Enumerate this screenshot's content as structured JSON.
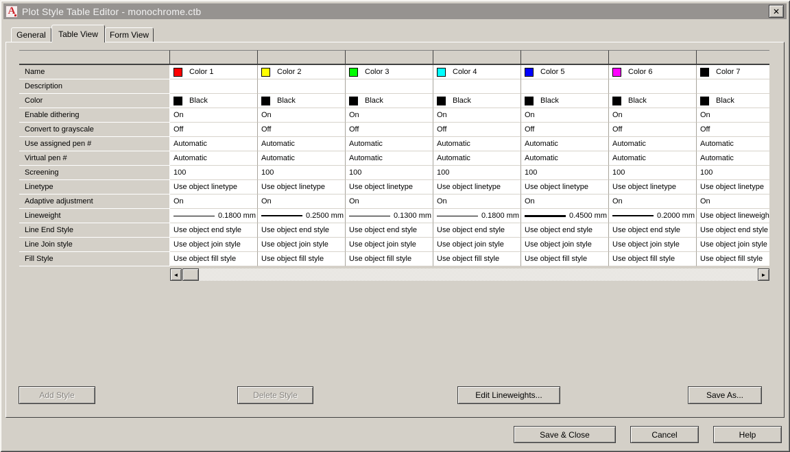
{
  "window": {
    "title": "Plot Style Table Editor - monochrome.ctb",
    "icon_letter": "A",
    "close_glyph": "✕"
  },
  "tabs": [
    {
      "label": "General",
      "active": false
    },
    {
      "label": "Table View",
      "active": true
    },
    {
      "label": "Form View",
      "active": false
    }
  ],
  "table": {
    "rows": [
      {
        "key": "name",
        "label": "Name",
        "kind": "name"
      },
      {
        "key": "description",
        "label": "Description",
        "kind": "text"
      },
      {
        "key": "color",
        "label": "Color",
        "kind": "swatchtext"
      },
      {
        "key": "enable_dithering",
        "label": "Enable dithering",
        "kind": "text"
      },
      {
        "key": "convert_to_grayscale",
        "label": "Convert to grayscale",
        "kind": "text"
      },
      {
        "key": "use_assigned_pen",
        "label": "Use assigned pen #",
        "kind": "text"
      },
      {
        "key": "virtual_pen",
        "label": "Virtual pen #",
        "kind": "text"
      },
      {
        "key": "screening",
        "label": "Screening",
        "kind": "text"
      },
      {
        "key": "linetype",
        "label": "Linetype",
        "kind": "text"
      },
      {
        "key": "adaptive_adjustment",
        "label": "Adaptive adjustment",
        "kind": "text"
      },
      {
        "key": "lineweight",
        "label": "Lineweight",
        "kind": "lineweight"
      },
      {
        "key": "line_end_style",
        "label": "Line End Style",
        "kind": "text"
      },
      {
        "key": "line_join_style",
        "label": "Line Join style",
        "kind": "text"
      },
      {
        "key": "fill_style",
        "label": "Fill Style",
        "kind": "text"
      }
    ],
    "columns": [
      {
        "name": "Color 1",
        "swatch": "#ff0000",
        "values": {
          "description": "",
          "color": "Black",
          "color_swatch": "#000000",
          "enable_dithering": "On",
          "convert_to_grayscale": "Off",
          "use_assigned_pen": "Automatic",
          "virtual_pen": "Automatic",
          "screening": "100",
          "linetype": "Use object linetype",
          "adaptive_adjustment": "On",
          "lineweight": "0.1800 mm",
          "lineweight_thickness": 1,
          "line_end_style": "Use object end style",
          "line_join_style": "Use object join style",
          "fill_style": "Use object fill style"
        }
      },
      {
        "name": "Color 2",
        "swatch": "#ffff00",
        "values": {
          "description": "",
          "color": "Black",
          "color_swatch": "#000000",
          "enable_dithering": "On",
          "convert_to_grayscale": "Off",
          "use_assigned_pen": "Automatic",
          "virtual_pen": "Automatic",
          "screening": "100",
          "linetype": "Use object linetype",
          "adaptive_adjustment": "On",
          "lineweight": "0.2500 mm",
          "lineweight_thickness": 2,
          "line_end_style": "Use object end style",
          "line_join_style": "Use object join style",
          "fill_style": "Use object fill style"
        }
      },
      {
        "name": "Color 3",
        "swatch": "#00ff00",
        "values": {
          "description": "",
          "color": "Black",
          "color_swatch": "#000000",
          "enable_dithering": "On",
          "convert_to_grayscale": "Off",
          "use_assigned_pen": "Automatic",
          "virtual_pen": "Automatic",
          "screening": "100",
          "linetype": "Use object linetype",
          "adaptive_adjustment": "On",
          "lineweight": "0.1300 mm",
          "lineweight_thickness": 1,
          "line_end_style": "Use object end style",
          "line_join_style": "Use object join style",
          "fill_style": "Use object fill style"
        }
      },
      {
        "name": "Color 4",
        "swatch": "#00ffff",
        "values": {
          "description": "",
          "color": "Black",
          "color_swatch": "#000000",
          "enable_dithering": "On",
          "convert_to_grayscale": "Off",
          "use_assigned_pen": "Automatic",
          "virtual_pen": "Automatic",
          "screening": "100",
          "linetype": "Use object linetype",
          "adaptive_adjustment": "On",
          "lineweight": "0.1800 mm",
          "lineweight_thickness": 1,
          "line_end_style": "Use object end style",
          "line_join_style": "Use object join style",
          "fill_style": "Use object fill style"
        }
      },
      {
        "name": "Color 5",
        "swatch": "#0000ff",
        "values": {
          "description": "",
          "color": "Black",
          "color_swatch": "#000000",
          "enable_dithering": "On",
          "convert_to_grayscale": "Off",
          "use_assigned_pen": "Automatic",
          "virtual_pen": "Automatic",
          "screening": "100",
          "linetype": "Use object linetype",
          "adaptive_adjustment": "On",
          "lineweight": "0.4500 mm",
          "lineweight_thickness": 3,
          "line_end_style": "Use object end style",
          "line_join_style": "Use object join style",
          "fill_style": "Use object fill style"
        }
      },
      {
        "name": "Color 6",
        "swatch": "#ff00ff",
        "values": {
          "description": "",
          "color": "Black",
          "color_swatch": "#000000",
          "enable_dithering": "On",
          "convert_to_grayscale": "Off",
          "use_assigned_pen": "Automatic",
          "virtual_pen": "Automatic",
          "screening": "100",
          "linetype": "Use object linetype",
          "adaptive_adjustment": "On",
          "lineweight": "0.2000 mm",
          "lineweight_thickness": 2,
          "line_end_style": "Use object end style",
          "line_join_style": "Use object join style",
          "fill_style": "Use object fill style"
        }
      },
      {
        "name": "Color 7",
        "swatch": "#000000",
        "values": {
          "description": "",
          "color": "Black",
          "color_swatch": "#000000",
          "enable_dithering": "On",
          "convert_to_grayscale": "Off",
          "use_assigned_pen": "Automatic",
          "virtual_pen": "Automatic",
          "screening": "100",
          "linetype": "Use object linetype",
          "adaptive_adjustment": "On",
          "lineweight": "Use object lineweight",
          "lineweight_thickness": 0,
          "line_end_style": "Use object end style",
          "line_join_style": "Use object join style",
          "fill_style": "Use object fill style"
        }
      }
    ]
  },
  "scrollbar": {
    "left_glyph": "◄",
    "right_glyph": "►"
  },
  "actions": {
    "add_style": "Add Style",
    "delete_style": "Delete Style",
    "edit_lineweights": "Edit Lineweights...",
    "save_as": "Save As...",
    "save_close": "Save & Close",
    "cancel": "Cancel",
    "help": "Help"
  },
  "colors": {
    "dialog_bg": "#d4d0c8",
    "titlebar_bg": "#969390",
    "accent_red": "#cc2229"
  }
}
